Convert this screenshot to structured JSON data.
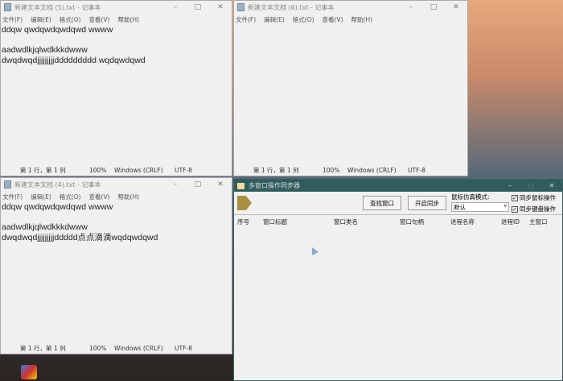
{
  "notepads": [
    {
      "title": "新建文本文档 (5).txt - 记事本",
      "lines": [
        "ddqw qwdqwdqwdqwd wwww",
        "",
        "aadwdlkjqlwdkkkdwww",
        "dwqdwqdjjjjjjjjjddddddddd wqdqwdqwd"
      ]
    },
    {
      "title": "新建文本文档 (6).txt - 记事本",
      "lines": []
    },
    {
      "title": "新建文本文档 (4).txt - 记事本",
      "lines": [
        "ddqw qwdqwdqwdqwd wwww",
        "",
        "aadwdlkjqlwdkkkdwww",
        "dwqdwqdjjjjjjjjjddddd点点滴滴wqdqwdqwd"
      ]
    }
  ],
  "menu": [
    "文件(F)",
    "编辑(E)",
    "格式(O)",
    "查看(V)",
    "帮助(H)"
  ],
  "status": {
    "pos": "第 1 行，第 1 列",
    "zoom": "100%",
    "eol": "Windows (CRLF)",
    "enc": "UTF-8"
  },
  "sync": {
    "title": "多窗口操作同步器",
    "find_btn": "查找窗口",
    "start_btn": "开启同步",
    "mode_label": "鼠标仿真模式:",
    "mode_value": "默认",
    "sync_mouse": "同步鼠标操作",
    "sync_keyboard": "同步键盘操作",
    "columns": [
      "序号",
      "窗口标题",
      "窗口类名",
      "窗口句柄",
      "进程名称",
      "进程ID",
      "主窗口"
    ]
  }
}
